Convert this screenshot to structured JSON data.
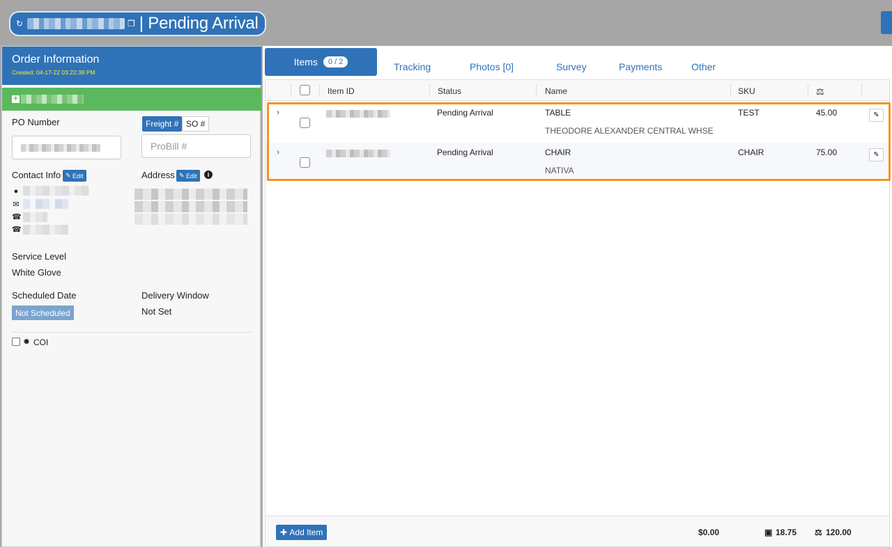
{
  "header": {
    "title": "| Pending Arrival",
    "refresh_icon": "refresh-icon",
    "copy_icon": "copy-icon"
  },
  "order": {
    "heading": "Order Information",
    "created": "Created: 04-17-22 03:22:38 PM",
    "po_label": "PO Number",
    "freight_toggle": "Freight #",
    "so_toggle": "SO #",
    "probill_placeholder": "ProBill #",
    "contact_label": "Contact Info",
    "address_label": "Address",
    "edit_label": "Edit",
    "service_level_label": "Service Level",
    "service_level_value": "White Glove",
    "scheduled_date_label": "Scheduled Date",
    "scheduled_date_value": "Not Scheduled",
    "delivery_window_label": "Delivery Window",
    "delivery_window_value": "Not Set",
    "coi_label": "COI"
  },
  "tabs": {
    "items": "Items",
    "items_badge": "0 / 2",
    "tracking": "Tracking",
    "photos": "Photos [0]",
    "survey": "Survey",
    "payments": "Payments",
    "other": "Other"
  },
  "table": {
    "columns": {
      "item_id": "Item ID",
      "status": "Status",
      "name": "Name",
      "sku": "SKU",
      "weight_icon": "scale-icon"
    },
    "rows": [
      {
        "status": "Pending Arrival",
        "name": "TABLE",
        "vendor": "THEODORE ALEXANDER CENTRAL WHSE",
        "sku": "TEST",
        "weight": "45.00"
      },
      {
        "status": "Pending Arrival",
        "name": "CHAIR",
        "vendor": "NATIVA",
        "sku": "CHAIR",
        "weight": "75.00"
      }
    ]
  },
  "footer": {
    "add_item": "Add Item",
    "total_cost": "$0.00",
    "total_volume": "18.75",
    "total_weight": "120.00"
  },
  "colors": {
    "primary": "#2f72b8",
    "success": "#5cb85c",
    "highlight": "#f7931e",
    "created": "#f2ee3c"
  }
}
